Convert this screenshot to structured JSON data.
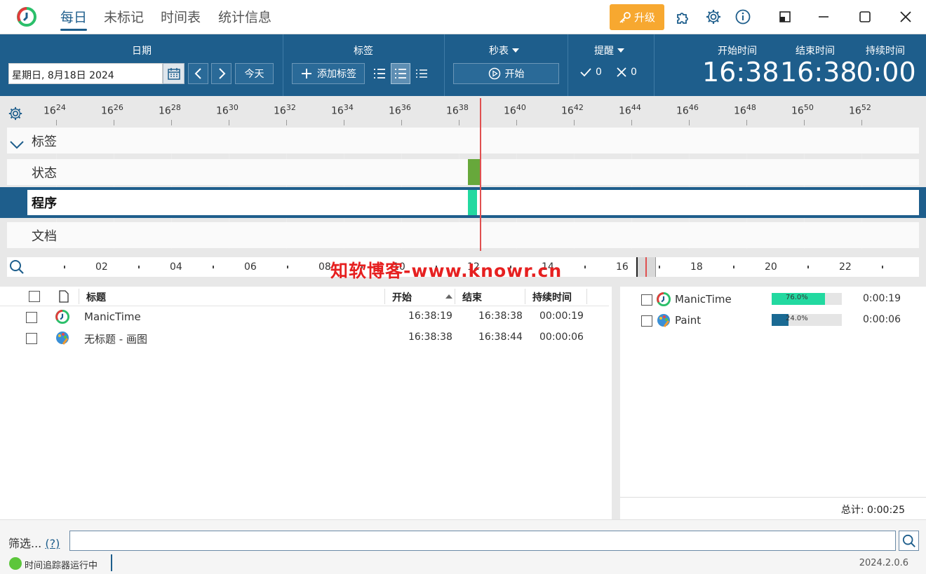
{
  "nav": {
    "tabs": [
      "每日",
      "未标记",
      "时间表",
      "统计信息"
    ],
    "upgrade_label": "升级"
  },
  "toolbar": {
    "date_title": "日期",
    "date_value": "星期日, 8月18日 2024",
    "today_label": "今天",
    "tags_title": "标签",
    "add_tag_label": "添加标签",
    "stopwatch_title": "秒表",
    "start_label": "开始",
    "reminder_title": "提醒",
    "reminder_done": "0",
    "reminder_dismissed": "0",
    "start_time_label": "开始时间",
    "start_time_value": "16:38",
    "end_time_label": "结束时间",
    "end_time_value": "16:38",
    "duration_label": "持续时间",
    "duration_value": "0:00"
  },
  "timeline": {
    "ruler": [
      {
        "h": "16",
        "m": "24"
      },
      {
        "h": "16",
        "m": "26"
      },
      {
        "h": "16",
        "m": "28"
      },
      {
        "h": "16",
        "m": "30"
      },
      {
        "h": "16",
        "m": "32"
      },
      {
        "h": "16",
        "m": "34"
      },
      {
        "h": "16",
        "m": "36"
      },
      {
        "h": "16",
        "m": "38"
      },
      {
        "h": "16",
        "m": "40"
      },
      {
        "h": "16",
        "m": "42"
      },
      {
        "h": "16",
        "m": "44"
      },
      {
        "h": "16",
        "m": "46"
      },
      {
        "h": "16",
        "m": "48"
      },
      {
        "h": "16",
        "m": "50"
      },
      {
        "h": "16",
        "m": "52"
      }
    ],
    "lanes": [
      "标签",
      "状态",
      "程序",
      "文档"
    ],
    "overview_labels": [
      "02",
      "04",
      "06",
      "08",
      "10",
      "12",
      "14",
      "16",
      "18",
      "20",
      "22"
    ],
    "watermark": "知软博客-www.knowr.cn",
    "colors": {
      "status_active": "#67a83b",
      "program_active": "#22d9a0",
      "now_line": "#e05050"
    }
  },
  "activity_table": {
    "headers": {
      "title": "标题",
      "start": "开始",
      "end": "结束",
      "duration": "持续时间"
    },
    "rows": [
      {
        "icon": "manictime-icon",
        "title": "ManicTime",
        "start": "16:38:19",
        "end": "16:38:38",
        "duration": "00:00:19"
      },
      {
        "icon": "paint-icon",
        "title": "无标题 - 画图",
        "start": "16:38:38",
        "end": "16:38:44",
        "duration": "00:00:06"
      }
    ]
  },
  "summary": {
    "rows": [
      {
        "icon": "manictime-icon",
        "name": "ManicTime",
        "percent_label": "76.0%",
        "percent": 76.0,
        "color": "#22d9a0",
        "duration": "0:00:19"
      },
      {
        "icon": "paint-icon",
        "name": "Paint",
        "percent_label": "24.0%",
        "percent": 24.0,
        "color": "#1a6a93",
        "duration": "0:00:06"
      }
    ],
    "total": "总计: 0:00:25"
  },
  "filter": {
    "label": "筛选...",
    "help": "(?)"
  },
  "status": {
    "tracker_text": "时间追踪器运行中",
    "version": "2024.2.0.6"
  }
}
